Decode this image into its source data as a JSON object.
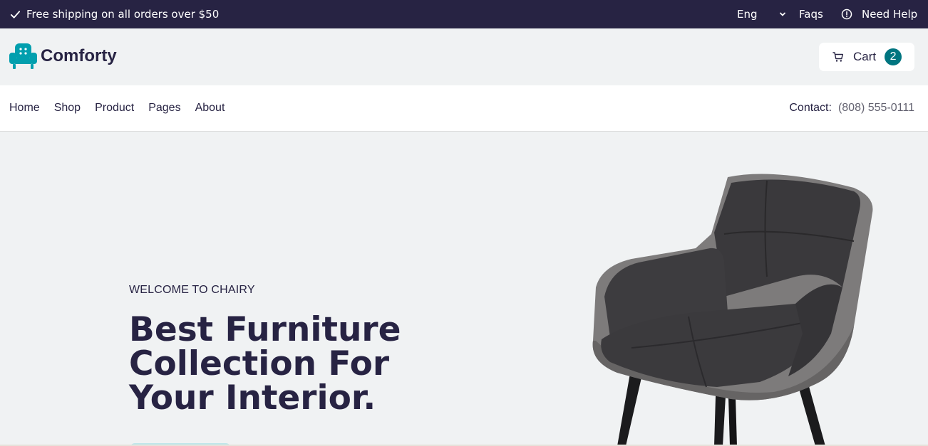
{
  "topbar": {
    "shipping_text": "Free shipping on all orders over $50",
    "language": "Eng",
    "faqs": "Faqs",
    "help": "Need Help"
  },
  "header": {
    "brand": "Comforty",
    "cart_label": "Cart",
    "cart_count": "2"
  },
  "nav": {
    "items": [
      "Home",
      "Shop",
      "Product",
      "Pages",
      "About"
    ],
    "contact_label": "Contact:",
    "contact_number": "(808) 555-0111"
  },
  "hero": {
    "kicker": "WELCOME TO CHAIRY",
    "title": "Best Furniture Collection For Your Interior."
  },
  "colors": {
    "topbar_bg": "#272343",
    "accent": "#007580",
    "logo": "#029fae"
  },
  "icons": {
    "shipping": "check-icon",
    "language": "chevron-down-icon",
    "help": "alert-circle-icon",
    "logo": "armchair-icon",
    "cart": "cart-icon"
  }
}
